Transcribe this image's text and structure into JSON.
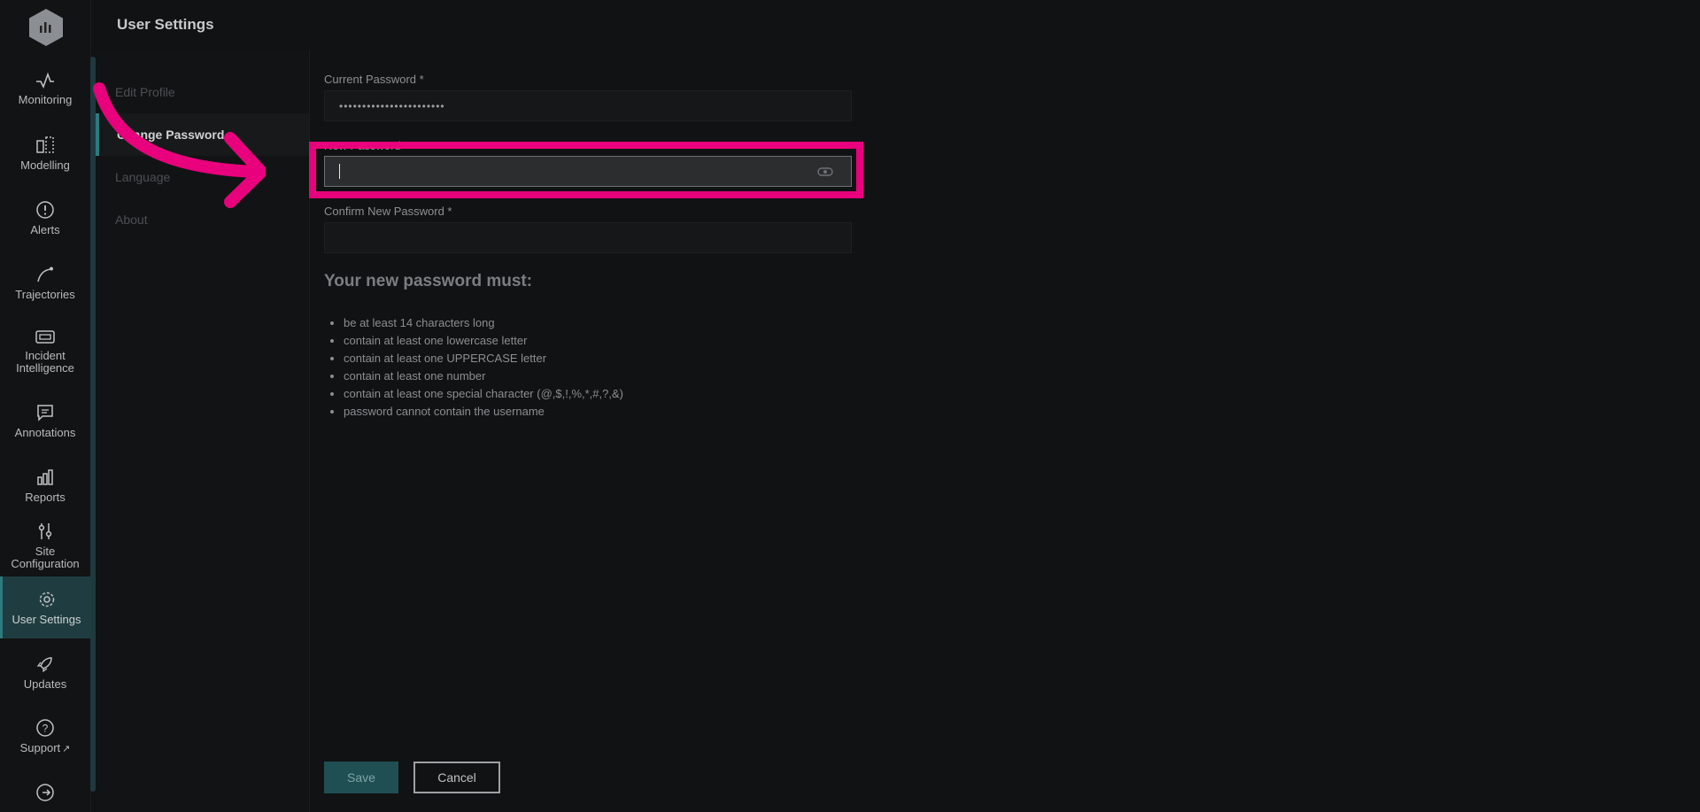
{
  "header": {
    "title": "User Settings"
  },
  "nav": {
    "items": [
      {
        "label": "Monitoring",
        "icon": "pulse-icon"
      },
      {
        "label": "Modelling",
        "icon": "modelling-icon"
      },
      {
        "label": "Alerts",
        "icon": "alert-circle-icon"
      },
      {
        "label": "Trajectories",
        "icon": "trajectory-icon"
      },
      {
        "label": "Incident Intelligence",
        "icon": "incident-icon"
      },
      {
        "label": "Annotations",
        "icon": "comment-icon"
      },
      {
        "label": "Reports",
        "icon": "bar-chart-icon"
      },
      {
        "label": "Site Configuration",
        "icon": "sliders-icon"
      },
      {
        "label": "User Settings",
        "icon": "gear-icon",
        "active": true
      },
      {
        "label": "Updates",
        "icon": "rocket-icon"
      },
      {
        "label": "Support",
        "icon": "help-circle-icon",
        "external": true
      },
      {
        "label": "",
        "icon": "logout-icon"
      }
    ]
  },
  "subnav": {
    "items": [
      {
        "label": "Edit Profile"
      },
      {
        "label": "Change Password",
        "active": true
      },
      {
        "label": "Language"
      },
      {
        "label": "About"
      }
    ]
  },
  "form": {
    "current_password_label": "Current Password *",
    "current_password_value": "•••••••••••••••••••••••",
    "new_password_label": "New Password *",
    "new_password_value": "",
    "confirm_password_label": "Confirm New Password *",
    "confirm_password_value": ""
  },
  "rules": {
    "title": "Your new password must:",
    "items": [
      "be at least 14 characters long",
      "contain at least one lowercase letter",
      "contain at least one UPPERCASE letter",
      "contain at least one number",
      "contain at least one special character (@,$,!,%,*,#,?,&)",
      "password cannot contain the username"
    ]
  },
  "buttons": {
    "save": "Save",
    "cancel": "Cancel"
  },
  "colors": {
    "accent": "#2f7a7f",
    "highlight": "#e8007c",
    "background": "#111213"
  }
}
